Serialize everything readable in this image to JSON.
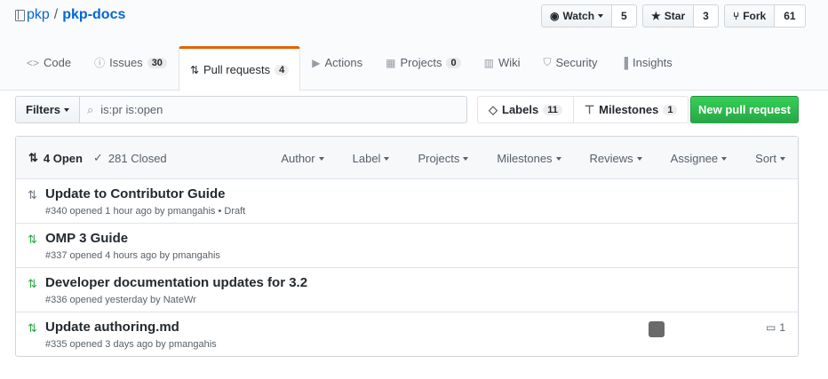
{
  "repo": {
    "owner": "pkp",
    "name": "pkp-docs"
  },
  "social": {
    "watch": {
      "label": "Watch",
      "count": "5"
    },
    "star": {
      "label": "Star",
      "count": "3"
    },
    "fork": {
      "label": "Fork",
      "count": "61"
    }
  },
  "tabs": [
    {
      "label": "Code",
      "icon": "code-icon",
      "count": null
    },
    {
      "label": "Issues",
      "icon": "issue-icon",
      "count": "30"
    },
    {
      "label": "Pull requests",
      "icon": "pull-request-icon",
      "count": "4"
    },
    {
      "label": "Actions",
      "icon": "play-icon",
      "count": null
    },
    {
      "label": "Projects",
      "icon": "project-icon",
      "count": "0"
    },
    {
      "label": "Wiki",
      "icon": "book-icon",
      "count": null
    },
    {
      "label": "Security",
      "icon": "shield-icon",
      "count": null
    },
    {
      "label": "Insights",
      "icon": "graph-icon",
      "count": null
    }
  ],
  "subnav": {
    "filters_label": "Filters",
    "search_value": "is:pr is:open",
    "labels": {
      "label": "Labels",
      "count": "11"
    },
    "milestones": {
      "label": "Milestones",
      "count": "1"
    },
    "new_pr_label": "New pull request"
  },
  "list": {
    "open_label": "4 Open",
    "closed_label": "281 Closed",
    "menus": [
      "Author",
      "Label",
      "Projects",
      "Milestones",
      "Reviews",
      "Assignee",
      "Sort"
    ]
  },
  "prs": [
    {
      "title": "Update to Contributor Guide",
      "meta": "#340 opened 1 hour ago by pmangahis • Draft",
      "draft": true,
      "comments": null
    },
    {
      "title": "OMP 3 Guide",
      "meta": "#337 opened 4 hours ago by pmangahis",
      "draft": false,
      "comments": null
    },
    {
      "title": "Developer documentation updates for 3.2",
      "meta": "#336 opened yesterday by NateWr",
      "draft": false,
      "comments": null
    },
    {
      "title": "Update authoring.md",
      "meta": "#335 opened 3 days ago by pmangahis",
      "draft": false,
      "comments": "1"
    }
  ],
  "colors": {
    "open_green": "#28a745",
    "draft_gray": "#6a737d",
    "link_blue": "#0366d6",
    "accent_orange": "#e36209"
  }
}
